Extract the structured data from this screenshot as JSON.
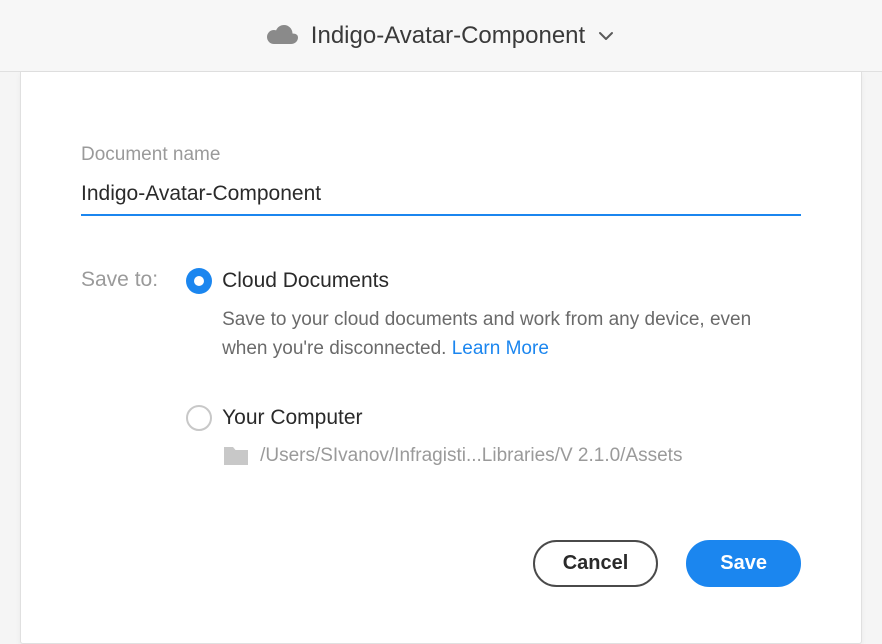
{
  "header": {
    "title": "Indigo-Avatar-Component"
  },
  "form": {
    "document_name_label": "Document name",
    "document_name_value": "Indigo-Avatar-Component",
    "save_to_label": "Save to:"
  },
  "options": {
    "cloud": {
      "title": "Cloud Documents",
      "description": "Save to your cloud documents and work from any device, even when you're disconnected. ",
      "learn_more": "Learn More",
      "selected": true
    },
    "local": {
      "title": "Your Computer",
      "path": "/Users/SIvanov/Infragisti...Libraries/V 2.1.0/Assets",
      "selected": false
    }
  },
  "buttons": {
    "cancel": "Cancel",
    "save": "Save"
  }
}
